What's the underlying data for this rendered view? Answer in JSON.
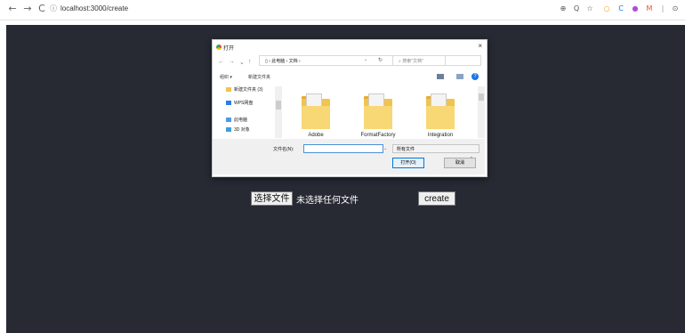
{
  "browser": {
    "url": "localhost:3000/create",
    "back_glyph": "←",
    "forward_glyph": "→",
    "reload_glyph": "C",
    "info_glyph": "ⓘ",
    "ext_glyphs": [
      "⊕",
      "Q",
      "☆",
      "○",
      "C",
      "●",
      "M",
      "|",
      "⊙"
    ],
    "ext_colors": [
      "#555555",
      "#555555",
      "#555555",
      "#f5a623",
      "#1a73e8",
      "#b14bd8",
      "#e8532a",
      "#999999",
      "#555555"
    ]
  },
  "page": {
    "bg": "#272a33",
    "file_button": "选择文件",
    "file_status": "未选择任何文件",
    "create_button": "create"
  },
  "dialog": {
    "title": "打开",
    "close": "×",
    "nav_back": "←",
    "nav_forward": "→",
    "nav_dropdown": "⌄",
    "nav_up": "↑",
    "path": "▯ › 此电脑 › 文档 ›",
    "path_dropdown": "⌄",
    "refresh": "↻",
    "search_placeholder": "⌕  搜索\"文档\"",
    "toolbar": {
      "organize": "组织 ▾",
      "new_folder": "新建文件夹",
      "help": "?"
    },
    "nav_pane": [
      {
        "label": "新建文件夹 (3)",
        "color": "#f1c34f"
      },
      {
        "label": "WPS网盘",
        "color": "#2b7de9"
      },
      {
        "label": "此电脑",
        "color": "#4a9ae8"
      },
      {
        "label": "3D 对象",
        "color": "#3aa0e0"
      }
    ],
    "files": [
      {
        "name": "Adobe"
      },
      {
        "name": "FormatFactory"
      },
      {
        "name": "Integration"
      }
    ],
    "filename_label": "文件名(N):",
    "filename_value": "",
    "filename_dropdown": "⌄",
    "filter": "所有文件",
    "filter_dropdown": "⌄",
    "open_button": "打开(O)",
    "cancel_button": "取消"
  }
}
